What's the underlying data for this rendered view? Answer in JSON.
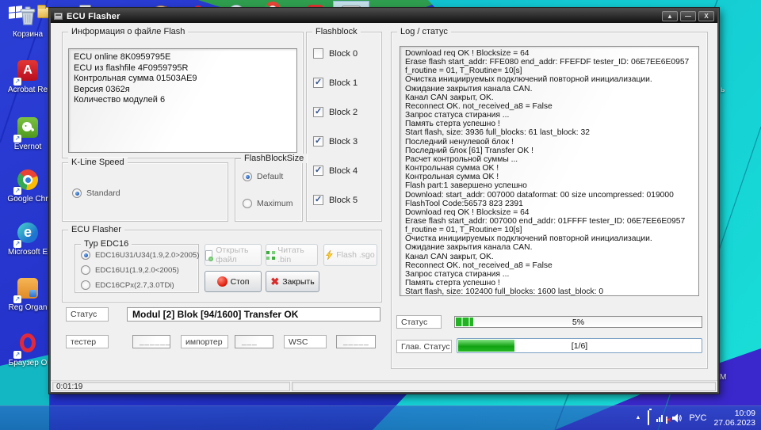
{
  "desktop": {
    "icons": [
      {
        "label": "Корзина"
      },
      {
        "label": "Acrobat Re"
      },
      {
        "label": "Evernot"
      },
      {
        "label": "Google Chr"
      },
      {
        "label": "Microsoft E"
      },
      {
        "label": "Reg Organ"
      },
      {
        "label": "Браузер O"
      }
    ],
    "edge_fragments": [
      {
        "text": "ь"
      },
      {
        "text": "М"
      }
    ]
  },
  "window": {
    "title": "ECU Flasher",
    "controls": {
      "maximize": "▲",
      "minimize": "—",
      "close": "X"
    },
    "file_info": {
      "title": "Информация  о файле Flash",
      "lines": [
        "ECU online 8K0959795E",
        "ECU из flashfile 4F0959795R",
        "Контрольная сумма 01503AE9",
        "Версия 0362я",
        "Количество модулей 6"
      ]
    },
    "flashblock": {
      "title": "Flashblock",
      "blocks": [
        {
          "label": "Block 0",
          "checked": false
        },
        {
          "label": "Block 1",
          "checked": true
        },
        {
          "label": "Block 2",
          "checked": true
        },
        {
          "label": "Block 3",
          "checked": true
        },
        {
          "label": "Block 4",
          "checked": true
        },
        {
          "label": "Block 5",
          "checked": true
        }
      ]
    },
    "kline": {
      "title": "K-Line Speed",
      "option": "Standard"
    },
    "flashblocksize": {
      "title": "FlashBlockSize",
      "option_default": "Default",
      "option_maximum": "Maximum"
    },
    "ecu_flasher": {
      "title": "ECU Flasher",
      "typ": {
        "title": "Typ EDC16",
        "options": [
          "EDC16U31/U34(1.9,2.0>2005)",
          "EDC16U1(1.9,2.0<2005)",
          "EDC16CPx(2.7,3.0TDi)"
        ]
      },
      "buttons": {
        "open": "Открыть файл",
        "read": "Читать .bin",
        "flash": "Flash .sgo",
        "stop": "Стоп",
        "close": "Закрыть"
      }
    },
    "status_row": {
      "label": "Статус",
      "value": "Modul [2] Blok [94/1600] Transfer OK"
    },
    "fields": {
      "tester_label": "тестер",
      "tester_value": "______",
      "importer_label": "импортер",
      "importer_value": "___",
      "wsc_label": "WSC",
      "wsc_value": "_____"
    },
    "log": {
      "title": "Log / статус",
      "lines": [
        "Download req OK ! Blocksize = 64",
        "Erase flash start_addr: FFE080 end_addr: FFEFDF tester_ID: 06E7EE6E0957",
        "f_routine = 01, T_Routine= 10[s]",
        "Очистка инициируемых подключений повторной инициализации.",
        "Ожидание закрытия канала CAN.",
        "Канал CAN закрыт, OK.",
        "Reconnect OK. not_received_a8 = False",
        "Запрос статуса стирания ...",
        "Память стерта успешно !",
        "Start flash, size: 3936 full_blocks: 61 last_block: 32",
        "Последний ненулевой блок !",
        "Последний блок [61] Transfer OK !",
        "Расчет контрольной суммы ...",
        "Контрольная сумма OK !",
        "Контрольная сумма OK !",
        "Flash part:1 завершено успешно",
        "Download: start_addr: 007000 dataformat: 00 size uncompressed: 019000",
        "FlashTool Code:56573 823 2391",
        "Download req OK ! Blocksize = 64",
        "Erase flash start_addr: 007000 end_addr: 01FFFF tester_ID: 06E7EE6E0957",
        "f_routine = 01, T_Routine= 10[s]",
        "Очистка инициируемых подключений повторной инициализации.",
        "Ожидание закрытия канала CAN.",
        "Канал CAN закрыт, OK.",
        "Reconnect OK. not_received_a8 = False",
        "Запрос статуса стирания ...",
        "Память стерта успешно !",
        "Start flash, size: 102400 full_blocks: 1600 last_block: 0"
      ]
    },
    "progress1": {
      "label": "Статус",
      "text": "5%",
      "percent": 5
    },
    "progress2": {
      "label": "Глав. Статус",
      "text": "[1/6]",
      "percent": 17
    },
    "statusbar": {
      "elapsed": "0:01:19"
    }
  },
  "taskbar": {
    "tray": {
      "lang": "РУС",
      "time": "10:09",
      "date": "27.06.2023"
    }
  },
  "colors": {
    "accent_green": "#12a212",
    "title_bg": "#1a1a1a",
    "wallpaper_cyan": "#14ccd6",
    "wallpaper_blue": "#2331c9"
  }
}
